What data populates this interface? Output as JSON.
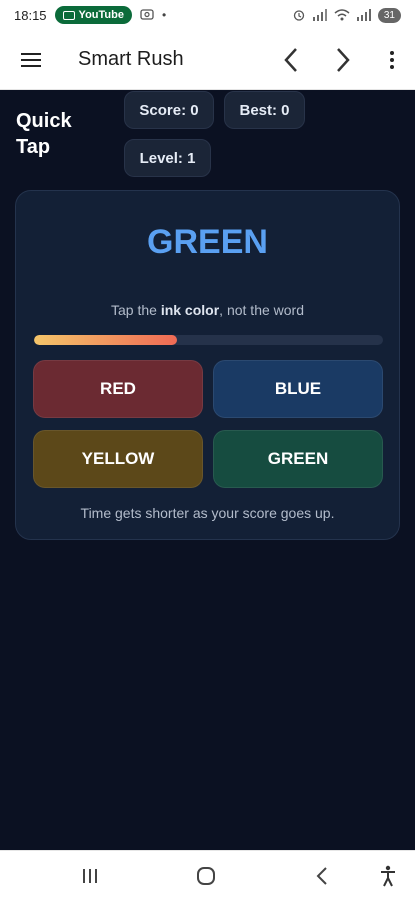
{
  "status_bar": {
    "time": "18:15",
    "notification_app": "YouTube",
    "battery": "31"
  },
  "app_bar": {
    "title": "Smart Rush"
  },
  "game": {
    "title_line1": "Quick",
    "title_line2": "Tap",
    "score_label": "Score: 0",
    "best_label": "Best: 0",
    "level_label": "Level: 1"
  },
  "card": {
    "word": "GREEN",
    "word_ink_color": "#5aa0f2",
    "instruction_prefix": "Tap the ",
    "instruction_bold": "ink color",
    "instruction_suffix": ", not the word",
    "timer_fraction": 0.41,
    "buttons": [
      "RED",
      "BLUE",
      "YELLOW",
      "GREEN"
    ],
    "button_colors": [
      "#6b2a32",
      "#1a3a64",
      "#5c4819",
      "#164c40"
    ],
    "hint": "Time gets shorter as your score goes up."
  },
  "icons": {
    "menu": "hamburger-icon",
    "back": "chevron-left-icon",
    "forward": "chevron-right-icon",
    "more": "more-vertical-icon",
    "nav_recents": "recents-icon",
    "nav_home": "home-icon",
    "nav_back": "back-icon",
    "nav_accessibility": "accessibility-icon"
  }
}
